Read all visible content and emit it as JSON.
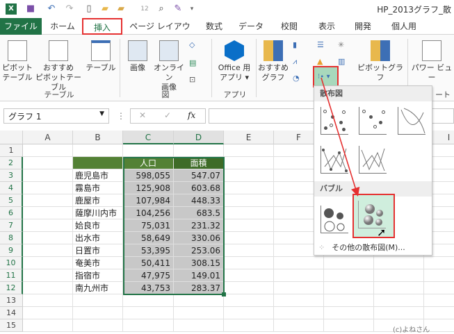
{
  "titlebar": {
    "title": "HP_2013グラフ_散",
    "qat": [
      "excel-icon",
      "save-icon",
      "undo-icon",
      "redo-icon",
      "new-icon",
      "open-icon",
      "folder-icon",
      "print-preview-icon",
      "search-icon",
      "form-icon",
      "customize-icon"
    ]
  },
  "tabs": [
    "ファイル",
    "ホーム",
    "挿入",
    "ページ レイアウト",
    "数式",
    "データ",
    "校閲",
    "表示",
    "開発",
    "個人用"
  ],
  "ribbon": {
    "pivot_table": [
      "ピボット",
      "テーブル"
    ],
    "recommended_pivot": [
      "おすすめ",
      "ピボットテーブル"
    ],
    "table": "テーブル",
    "group_table": "テーブル",
    "picture": "画像",
    "online_picture": [
      "オンライン",
      "画像"
    ],
    "group_illustrations": "図",
    "office_apps": [
      "Office 用",
      "アプリ ▾"
    ],
    "group_apps": "アプリ",
    "recommended_charts": [
      "おすすめ",
      "グラフ"
    ],
    "pivot_chart": "ピボットグラフ",
    "power_view": "パワー ビュー",
    "group_chart_partial": "ート"
  },
  "formula": {
    "name_box": "グラフ 1",
    "cancel": "✕",
    "enter": "✓",
    "fx": "fx",
    "value": ""
  },
  "columns": [
    "A",
    "B",
    "C",
    "D",
    "E",
    "F",
    "I"
  ],
  "rows": [
    "1",
    "2",
    "3",
    "4",
    "5",
    "6",
    "7",
    "8",
    "9",
    "10",
    "11",
    "12",
    "13",
    "14",
    "15"
  ],
  "table": {
    "headers": [
      "人口",
      "面積"
    ],
    "data": [
      [
        "鹿児島市",
        "598,055",
        "547.07"
      ],
      [
        "霧島市",
        "125,908",
        "603.68"
      ],
      [
        "鹿屋市",
        "107,984",
        "448.33"
      ],
      [
        "薩摩川内市",
        "104,256",
        "683.5"
      ],
      [
        "姶良市",
        "75,031",
        "231.32"
      ],
      [
        "出水市",
        "58,649",
        "330.06"
      ],
      [
        "日置市",
        "53,395",
        "253.06"
      ],
      [
        "奄美市",
        "50,411",
        "308.15"
      ],
      [
        "指宿市",
        "47,975",
        "149.01"
      ],
      [
        "南九州市",
        "43,753",
        "283.37"
      ]
    ]
  },
  "menu": {
    "scatter_header": "散布図",
    "bubble_header": "バブル",
    "more": "その他の散布図(M)..."
  },
  "watermark": "(c)よねさん",
  "colors": {
    "excel_green": "#217346",
    "header_green": "#538135",
    "header_dark": "#3e6b27",
    "highlight": "#e53030",
    "hover": "#cfeedd"
  }
}
